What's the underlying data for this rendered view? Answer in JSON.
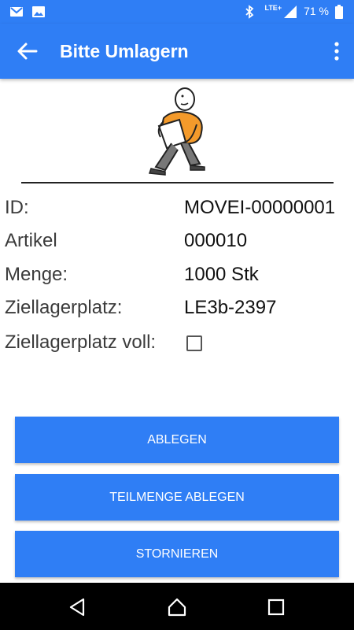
{
  "status_bar": {
    "network": "LTE+",
    "battery": "71 %",
    "left_icons": [
      "gmail-icon",
      "image-icon"
    ],
    "right_icons": [
      "bluetooth-icon",
      "signal-icon",
      "battery-icon"
    ]
  },
  "app_bar": {
    "title": "Bitte Umlagern",
    "back_icon": "arrow-left-icon",
    "menu_icon": "more-vert-icon"
  },
  "details": {
    "id_label": "ID:",
    "id_value": "MOVEI-00000001",
    "artikel_label": "Artikel",
    "artikel_value": "000010",
    "menge_label": "Menge:",
    "menge_value": "1000 Stk",
    "ziellagerplatz_label": "Ziellagerplatz:",
    "ziellagerplatz_value": "LE3b-2397",
    "voll_label": "Ziellagerplatz voll:",
    "voll_checked": false
  },
  "buttons": {
    "ablegen": "ABLEGEN",
    "teilmenge": "TEILMENGE ABLEGEN",
    "stornieren": "STORNIEREN"
  },
  "colors": {
    "primary": "#2f7ef5",
    "nav_bar": "#000000"
  }
}
